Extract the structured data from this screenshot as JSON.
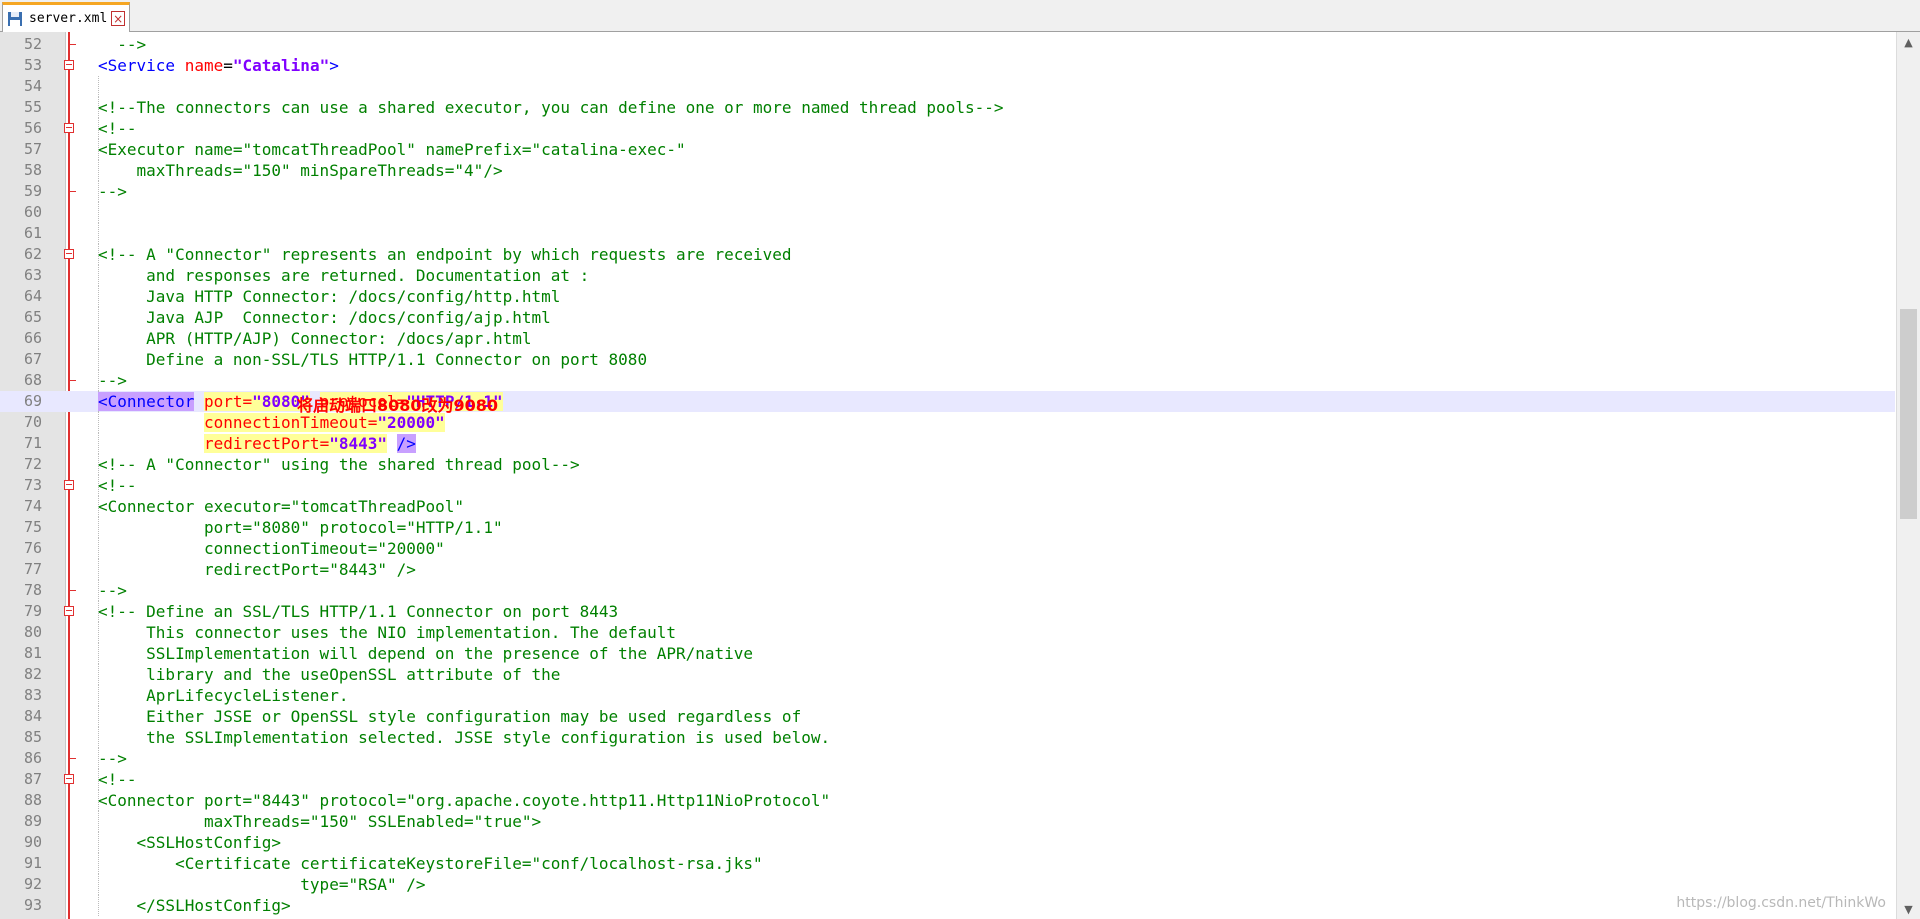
{
  "tab": {
    "filename": "server.xml",
    "save_icon": "floppy-disk-icon",
    "close_icon": "close-icon"
  },
  "annotation": "将启动端口8080改为9080",
  "watermark": "https://blog.csdn.net/ThinkWo",
  "colors": {
    "comment": "#008000",
    "tag": "#0000ff",
    "attr": "#ff0000",
    "value": "#8000ff",
    "highlight_line": "#e8e8ff",
    "edge_line": "#e03030"
  },
  "lines": [
    {
      "n": "52",
      "fold": "end",
      "indent": 0,
      "parts": [
        {
          "t": "  -->",
          "c": "comment"
        }
      ]
    },
    {
      "n": "53",
      "fold": "box",
      "indent": 0,
      "parts": [
        {
          "t": "<Service",
          "c": "tag"
        },
        {
          "t": " "
        },
        {
          "t": "name",
          "c": "attr"
        },
        {
          "t": "=",
          "c": "plain"
        },
        {
          "t": "\"Catalina\"",
          "c": "val"
        },
        {
          "t": ">",
          "c": "tag"
        }
      ]
    },
    {
      "n": "54",
      "fold": "",
      "indent": 1,
      "parts": []
    },
    {
      "n": "55",
      "fold": "",
      "indent": 1,
      "parts": [
        {
          "t": "<!--The connectors can use a shared executor, you can define one or more named thread pools-->",
          "c": "comment"
        }
      ]
    },
    {
      "n": "56",
      "fold": "box",
      "indent": 1,
      "parts": [
        {
          "t": "<!--",
          "c": "comment"
        }
      ]
    },
    {
      "n": "57",
      "fold": "",
      "indent": 1,
      "parts": [
        {
          "t": "<Executor name=\"tomcatThreadPool\" namePrefix=\"catalina-exec-\"",
          "c": "comment"
        }
      ]
    },
    {
      "n": "58",
      "fold": "",
      "indent": 1,
      "parts": [
        {
          "t": "    maxThreads=\"150\" minSpareThreads=\"4\"/>",
          "c": "comment"
        }
      ]
    },
    {
      "n": "59",
      "fold": "end",
      "indent": 1,
      "parts": [
        {
          "t": "-->",
          "c": "comment"
        }
      ]
    },
    {
      "n": "60",
      "fold": "",
      "indent": 1,
      "parts": []
    },
    {
      "n": "61",
      "fold": "",
      "indent": 1,
      "parts": []
    },
    {
      "n": "62",
      "fold": "box",
      "indent": 1,
      "parts": [
        {
          "t": "<!-- A \"Connector\" represents an endpoint by which requests are received",
          "c": "comment"
        }
      ]
    },
    {
      "n": "63",
      "fold": "",
      "indent": 1,
      "parts": [
        {
          "t": "     and responses are returned. Documentation at :",
          "c": "comment"
        }
      ]
    },
    {
      "n": "64",
      "fold": "",
      "indent": 1,
      "parts": [
        {
          "t": "     Java HTTP Connector: /docs/config/http.html",
          "c": "comment"
        }
      ]
    },
    {
      "n": "65",
      "fold": "",
      "indent": 1,
      "parts": [
        {
          "t": "     Java AJP  Connector: /docs/config/ajp.html",
          "c": "comment"
        }
      ]
    },
    {
      "n": "66",
      "fold": "",
      "indent": 1,
      "parts": [
        {
          "t": "     APR (HTTP/AJP) Connector: /docs/apr.html",
          "c": "comment"
        }
      ]
    },
    {
      "n": "67",
      "fold": "",
      "indent": 1,
      "parts": [
        {
          "t": "     Define a non-SSL/TLS HTTP/1.1 Connector on port 8080",
          "c": "comment"
        }
      ]
    },
    {
      "n": "68",
      "fold": "end",
      "indent": 1,
      "parts": [
        {
          "t": "-->",
          "c": "comment"
        }
      ]
    },
    {
      "n": "69",
      "fold": "",
      "indent": 1,
      "hl": true,
      "parts": [
        {
          "t": "<Connector",
          "c": "tag",
          "bg": "tag"
        },
        {
          "t": " "
        },
        {
          "t": "port=",
          "c": "attr",
          "bg": "attr"
        },
        {
          "t": "\"8080\"",
          "c": "val",
          "bg": "attr"
        },
        {
          "t": " "
        },
        {
          "t": "protocol=",
          "c": "attr",
          "bg": "attr"
        },
        {
          "t": "\"HTTP/1.1\"",
          "c": "val",
          "bg": "attr"
        }
      ]
    },
    {
      "n": "70",
      "fold": "",
      "indent": 1,
      "parts": [
        {
          "t": "           "
        },
        {
          "t": "connectionTimeout=",
          "c": "attr",
          "bg": "attr"
        },
        {
          "t": "\"20000\"",
          "c": "val",
          "bg": "attr"
        }
      ]
    },
    {
      "n": "71",
      "fold": "",
      "indent": 1,
      "parts": [
        {
          "t": "           "
        },
        {
          "t": "redirectPort=",
          "c": "attr",
          "bg": "attr"
        },
        {
          "t": "\"8443\"",
          "c": "val",
          "bg": "attr"
        },
        {
          "t": " "
        },
        {
          "t": "/>",
          "c": "tag",
          "bg": "tag"
        }
      ]
    },
    {
      "n": "72",
      "fold": "",
      "indent": 1,
      "parts": [
        {
          "t": "<!-- A \"Connector\" using the shared thread pool-->",
          "c": "comment"
        }
      ]
    },
    {
      "n": "73",
      "fold": "box",
      "indent": 1,
      "parts": [
        {
          "t": "<!--",
          "c": "comment"
        }
      ]
    },
    {
      "n": "74",
      "fold": "",
      "indent": 1,
      "parts": [
        {
          "t": "<Connector executor=\"tomcatThreadPool\"",
          "c": "comment"
        }
      ]
    },
    {
      "n": "75",
      "fold": "",
      "indent": 1,
      "parts": [
        {
          "t": "           port=\"8080\" protocol=\"HTTP/1.1\"",
          "c": "comment"
        }
      ]
    },
    {
      "n": "76",
      "fold": "",
      "indent": 1,
      "parts": [
        {
          "t": "           connectionTimeout=\"20000\"",
          "c": "comment"
        }
      ]
    },
    {
      "n": "77",
      "fold": "",
      "indent": 1,
      "parts": [
        {
          "t": "           redirectPort=\"8443\" />",
          "c": "comment"
        }
      ]
    },
    {
      "n": "78",
      "fold": "end",
      "indent": 1,
      "parts": [
        {
          "t": "-->",
          "c": "comment"
        }
      ]
    },
    {
      "n": "79",
      "fold": "box",
      "indent": 1,
      "parts": [
        {
          "t": "<!-- Define an SSL/TLS HTTP/1.1 Connector on port 8443",
          "c": "comment"
        }
      ]
    },
    {
      "n": "80",
      "fold": "",
      "indent": 1,
      "parts": [
        {
          "t": "     This connector uses the NIO implementation. The default",
          "c": "comment"
        }
      ]
    },
    {
      "n": "81",
      "fold": "",
      "indent": 1,
      "parts": [
        {
          "t": "     SSLImplementation will depend on the presence of the APR/native",
          "c": "comment"
        }
      ]
    },
    {
      "n": "82",
      "fold": "",
      "indent": 1,
      "parts": [
        {
          "t": "     library and the useOpenSSL attribute of the",
          "c": "comment"
        }
      ]
    },
    {
      "n": "83",
      "fold": "",
      "indent": 1,
      "parts": [
        {
          "t": "     AprLifecycleListener.",
          "c": "comment"
        }
      ]
    },
    {
      "n": "84",
      "fold": "",
      "indent": 1,
      "parts": [
        {
          "t": "     Either JSSE or OpenSSL style configuration may be used regardless of",
          "c": "comment"
        }
      ]
    },
    {
      "n": "85",
      "fold": "",
      "indent": 1,
      "parts": [
        {
          "t": "     the SSLImplementation selected. JSSE style configuration is used below.",
          "c": "comment"
        }
      ]
    },
    {
      "n": "86",
      "fold": "end",
      "indent": 1,
      "parts": [
        {
          "t": "-->",
          "c": "comment"
        }
      ]
    },
    {
      "n": "87",
      "fold": "box",
      "indent": 1,
      "parts": [
        {
          "t": "<!--",
          "c": "comment"
        }
      ]
    },
    {
      "n": "88",
      "fold": "",
      "indent": 1,
      "parts": [
        {
          "t": "<Connector port=\"8443\" protocol=\"org.apache.coyote.http11.Http11NioProtocol\"",
          "c": "comment"
        }
      ]
    },
    {
      "n": "89",
      "fold": "",
      "indent": 1,
      "parts": [
        {
          "t": "           maxThreads=\"150\" SSLEnabled=\"true\">",
          "c": "comment"
        }
      ]
    },
    {
      "n": "90",
      "fold": "",
      "indent": 1,
      "parts": [
        {
          "t": "    <SSLHostConfig>",
          "c": "comment"
        }
      ]
    },
    {
      "n": "91",
      "fold": "",
      "indent": 1,
      "parts": [
        {
          "t": "        <Certificate certificateKeystoreFile=\"conf/localhost-rsa.jks\"",
          "c": "comment"
        }
      ]
    },
    {
      "n": "92",
      "fold": "",
      "indent": 1,
      "parts": [
        {
          "t": "                     type=\"RSA\" />",
          "c": "comment"
        }
      ]
    },
    {
      "n": "93",
      "fold": "",
      "indent": 1,
      "parts": [
        {
          "t": "    </SSLHostConfig>",
          "c": "comment"
        }
      ]
    }
  ]
}
